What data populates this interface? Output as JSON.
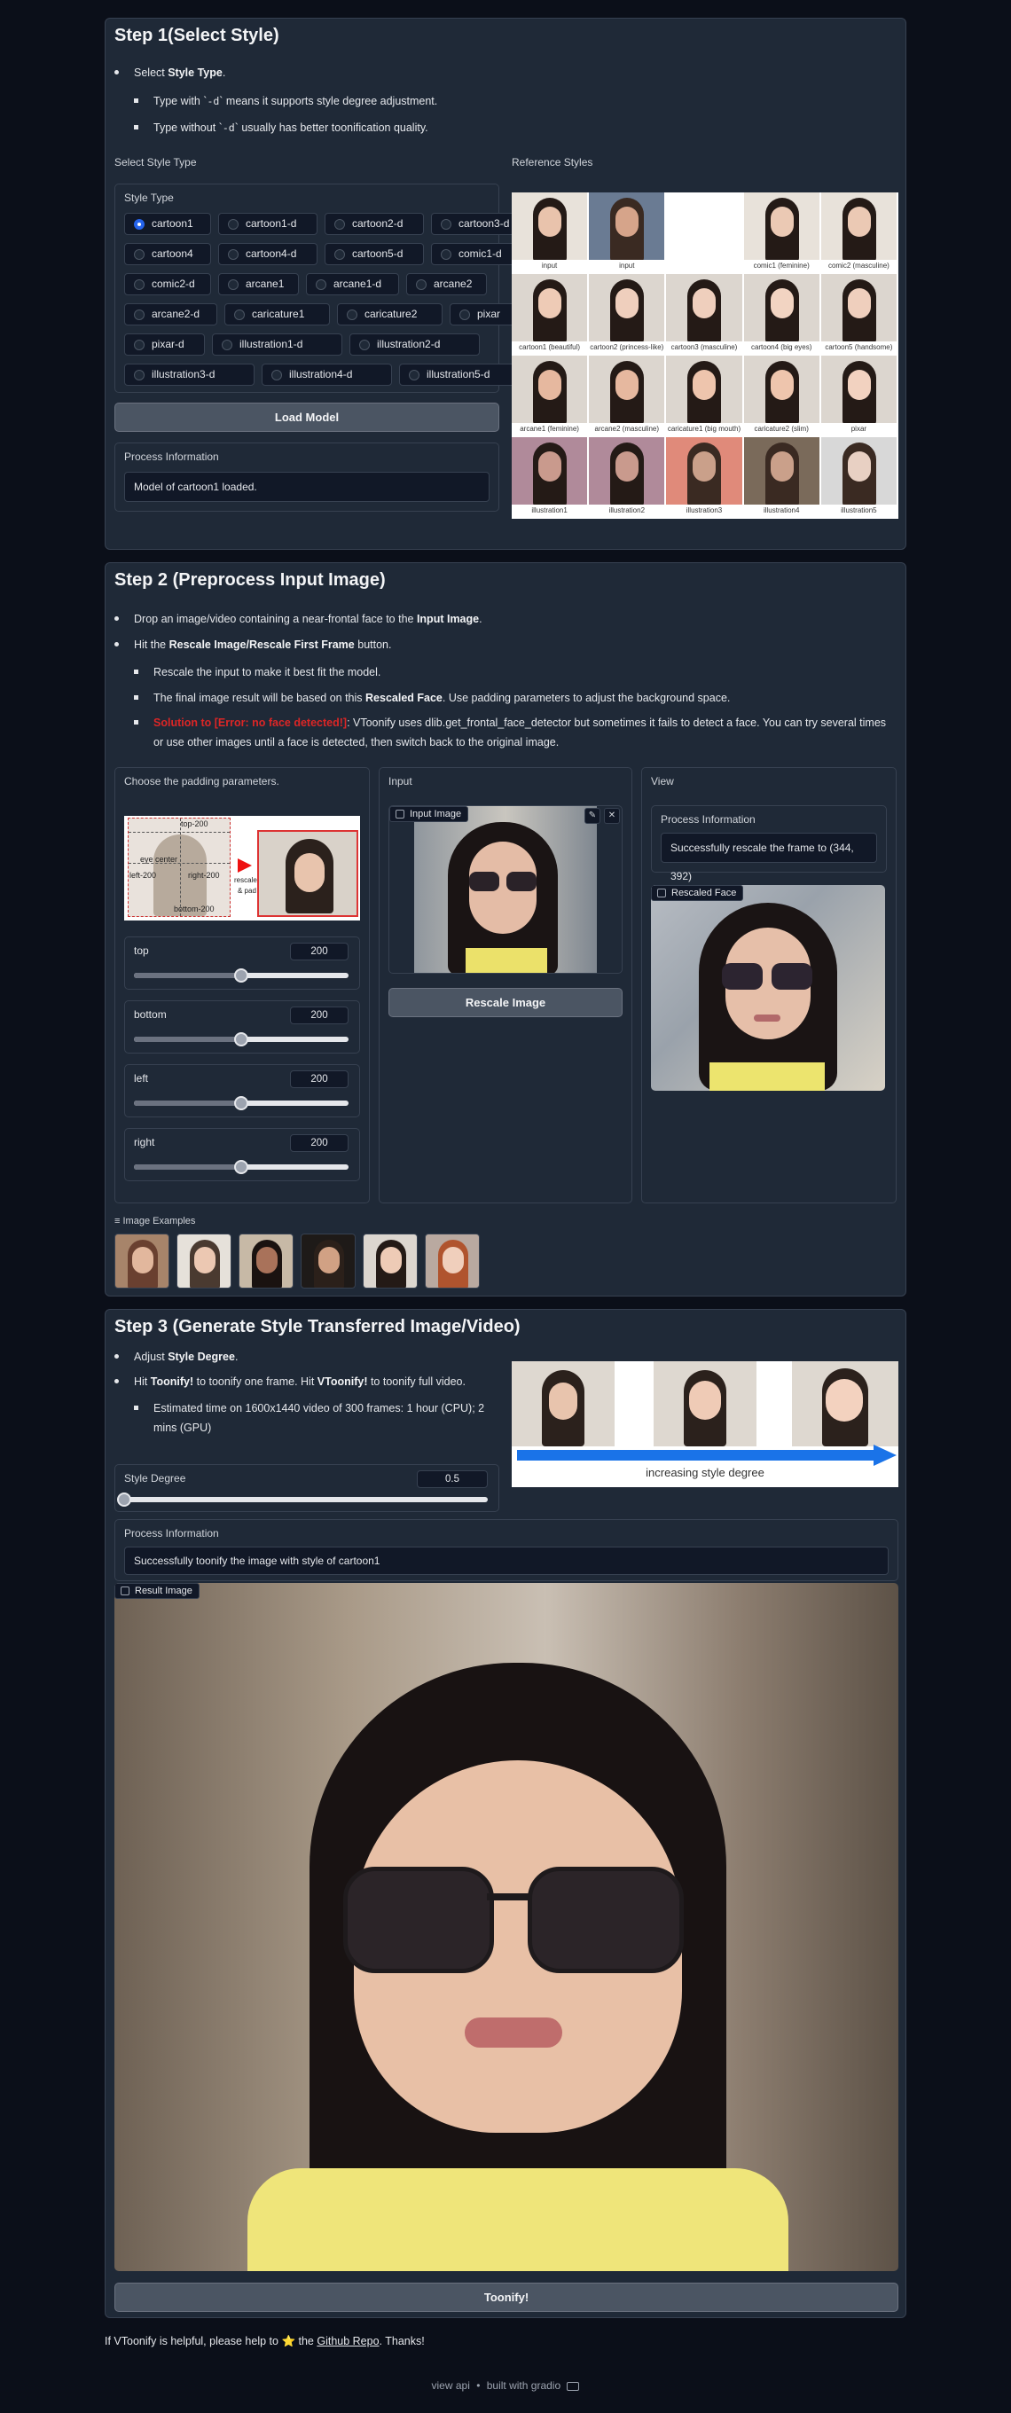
{
  "step1": {
    "title": "Step 1(Select Style)",
    "b1_pre": "Select ",
    "b1_bold": "Style Type",
    "b1_post": ".",
    "s1_pre": "Type with `",
    "s1_code": "-d",
    "s1_post": "` means it supports style degree adjustment.",
    "s2_pre": "Type without `",
    "s2_code": "-d",
    "s2_post": "` usually has better toonification quality.",
    "select_label": "Select Style Type",
    "ref_label": "Reference Styles",
    "style_type_label": "Style Type",
    "styles": [
      "cartoon1",
      "cartoon1-d",
      "cartoon2-d",
      "cartoon3-d",
      "cartoon4",
      "cartoon4-d",
      "cartoon5-d",
      "comic1-d",
      "comic2-d",
      "arcane1",
      "arcane1-d",
      "arcane2",
      "arcane2-d",
      "caricature1",
      "caricature2",
      "pixar",
      "pixar-d",
      "illustration1-d",
      "illustration2-d",
      "illustration3-d",
      "illustration4-d",
      "illustration5-d"
    ],
    "selected_style": "cartoon1",
    "load_button": "Load Model",
    "process_label": "Process Information",
    "process_text": "Model of cartoon1 loaded.",
    "ref_captions": [
      "input",
      "input",
      "",
      "comic1 (feminine)",
      "comic2 (masculine)",
      "cartoon1 (beautiful)",
      "cartoon2 (princess-like)",
      "cartoon3 (masculine)",
      "cartoon4 (big eyes)",
      "cartoon5 (handsome)",
      "arcane1 (feminine)",
      "arcane2 (masculine)",
      "caricature1 (big mouth)",
      "caricature2 (slim)",
      "pixar",
      "illustration1",
      "illustration2",
      "illustration3",
      "illustration4",
      "illustration5"
    ]
  },
  "step2": {
    "title": "Step 2 (Preprocess Input Image)",
    "b1_pre": "Drop an image/video containing a near-frontal face to the ",
    "b1_bold": "Input Image",
    "b1_post": ".",
    "b2_pre": "Hit the ",
    "b2_bold": "Rescale Image/Rescale First Frame",
    "b2_post": " button.",
    "s1": "Rescale the input to make it best fit the model.",
    "s2_pre": "The final image result will be based on this ",
    "s2_bold": "Rescaled Face",
    "s2_post": ". Use padding parameters to adjust the background space.",
    "s3_red": "Solution to [Error: no face detected!]",
    "s3_text": ": VToonify uses dlib.get_frontal_face_detector but sometimes it fails to detect a face. You can try several times or use other images until a face is detected, then switch back to the original image.",
    "padding_label": "Choose the padding parameters.",
    "diagram": {
      "top": "top-200",
      "bottom": "bottom-200",
      "left": "left-200",
      "right": "right-200",
      "eye": "eye center",
      "rescale": "rescale",
      "pad": "& pad"
    },
    "sliders": [
      {
        "name": "top",
        "value": "200",
        "fraction": 0.5
      },
      {
        "name": "bottom",
        "value": "200",
        "fraction": 0.5
      },
      {
        "name": "left",
        "value": "200",
        "fraction": 0.5
      },
      {
        "name": "right",
        "value": "200",
        "fraction": 0.5
      }
    ],
    "input_label": "Input",
    "input_image_tag": "Input Image",
    "rescale_button": "Rescale Image",
    "view_label": "View",
    "process_label": "Process Information",
    "process_text": "Successfully rescale the frame to (344, 392)",
    "rescaled_tag": "Rescaled Face",
    "examples_label": "Image Examples"
  },
  "step3": {
    "title": "Step 3 (Generate Style Transferred Image/Video)",
    "b1_pre": "Adjust ",
    "b1_bold": "Style Degree",
    "b1_post": ".",
    "b2_pre": "Hit ",
    "b2_bold1": "Toonify!",
    "b2_mid": " to toonify one frame. Hit ",
    "b2_bold2": "VToonify!",
    "b2_post": " to toonify full video.",
    "s1": "Estimated time on 1600x1440 video of 300 frames: 1 hour (CPU); 2 mins (GPU)",
    "degree_label": "Style Degree",
    "degree_value": "0.5",
    "degree_fraction": 0.0,
    "degree_banner": "increasing style degree",
    "process_label": "Process Information",
    "process_text": "Successfully toonify the image with style of cartoon1",
    "result_tag": "Result Image",
    "toonify_button": "Toonify!"
  },
  "footer": {
    "pre": "If VToonify is helpful, please help to ",
    "star": "⭐",
    "mid": " the ",
    "link": "Github Repo",
    "post": ". Thanks!",
    "api": "view api",
    "sep": "•",
    "built": "built with gradio"
  },
  "colors": {
    "accent": "#2563eb",
    "error": "#dc2626",
    "bg": "#0b0f19",
    "panel": "#1f2937"
  }
}
